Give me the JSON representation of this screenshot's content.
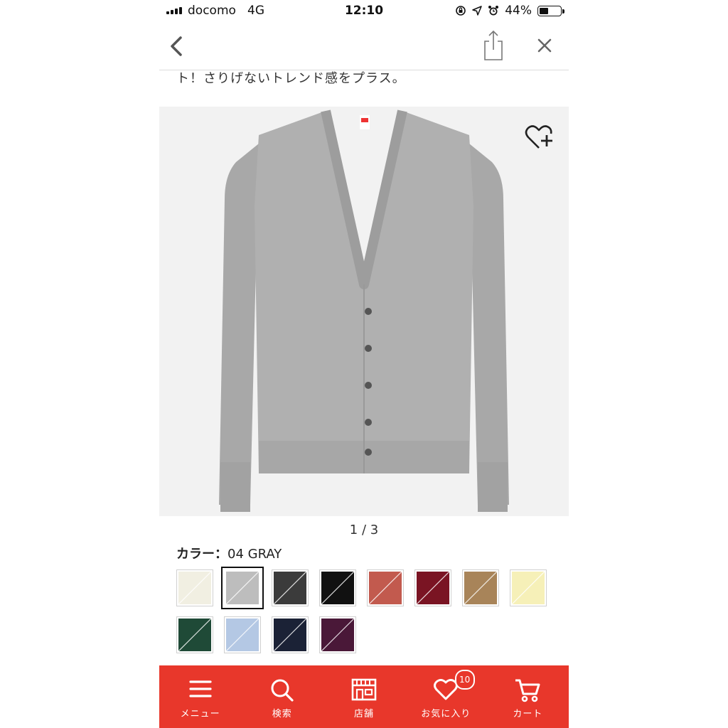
{
  "status_bar": {
    "carrier": "docomo",
    "network": "4G",
    "time": "12:10",
    "battery_text": "44%",
    "battery_level": 0.44
  },
  "nav": {
    "back_icon": "chevron-left-icon",
    "share_icon": "share-icon",
    "close_icon": "close-icon"
  },
  "description_tail": "ト！さりげないトレンド感をプラス。",
  "product": {
    "image_icon": "gray-cardigan-photo",
    "favorite_icon": "heart-plus-icon",
    "pager": "1 / 3"
  },
  "color": {
    "label": "カラー：",
    "value": "04 GRAY",
    "swatches": [
      {
        "color": "#f1efe2",
        "selected": false
      },
      {
        "color": "#bdbdbd",
        "selected": true
      },
      {
        "color": "#3b3b3b",
        "selected": false
      },
      {
        "color": "#111111",
        "selected": false
      },
      {
        "color": "#c25a4e",
        "selected": false
      },
      {
        "color": "#7a1423",
        "selected": false
      },
      {
        "color": "#a88459",
        "selected": false
      },
      {
        "color": "#f6f0b8",
        "selected": false
      },
      {
        "color": "#1f4a37",
        "selected": false
      },
      {
        "color": "#b4c8e4",
        "selected": false
      },
      {
        "color": "#1b2236",
        "selected": false
      },
      {
        "color": "#4a1838",
        "selected": false
      }
    ]
  },
  "tabbar": {
    "accent": "#e8372b",
    "items": [
      {
        "label": "メニュー",
        "icon": "menu-icon"
      },
      {
        "label": "検索",
        "icon": "search-icon"
      },
      {
        "label": "店舗",
        "icon": "store-icon"
      },
      {
        "label": "お気に入り",
        "icon": "heart-icon",
        "badge": "10"
      },
      {
        "label": "カート",
        "icon": "cart-icon"
      }
    ]
  }
}
